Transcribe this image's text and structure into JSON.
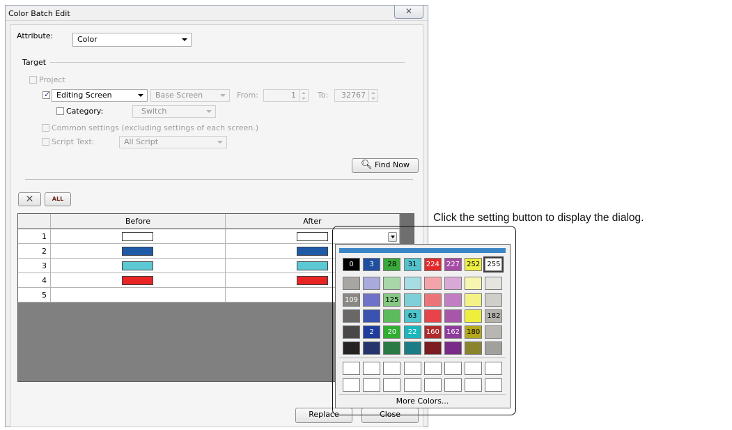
{
  "window": {
    "title": "Color Batch Edit",
    "close_glyph": "✕"
  },
  "attribute": {
    "label": "Attribute:",
    "value": "Color"
  },
  "target": {
    "label": "Target",
    "project_label": "Project",
    "scope_value": "Editing Screen",
    "screen_type": "Base Screen",
    "from_label": "From:",
    "from_value": "1",
    "to_label": "To:",
    "to_value": "32767",
    "category_label": "Category:",
    "category_value": "Switch",
    "common_label": "Common settings (excluding settings of each screen.)",
    "script_label": "Script Text:",
    "script_value": "All Script",
    "checks": {
      "project": false,
      "editing_screen": true,
      "category": false,
      "common": false,
      "script": false
    }
  },
  "find_now_label": "Find Now",
  "toolbar": {
    "delete_icon": "x-icon",
    "all_icon": "all-icon",
    "all_text": "ALL"
  },
  "table": {
    "headers": [
      "Before",
      "After"
    ],
    "rows": [
      {
        "no": "1",
        "before": "#ffffff",
        "after": "#ffffff"
      },
      {
        "no": "2",
        "before": "#1f5aa8",
        "after": "#1f5aa8"
      },
      {
        "no": "3",
        "before": "#5cc8d4",
        "after": "#5cc8d4"
      },
      {
        "no": "4",
        "before": "#e82424",
        "after": "#e82424"
      },
      {
        "no": "5",
        "before": "",
        "after": ""
      }
    ]
  },
  "buttons": {
    "replace": "Replace",
    "close": "Close"
  },
  "palette": {
    "rows": [
      [
        {
          "c": "#000000",
          "t": "0",
          "fg": "#ffffff"
        },
        {
          "c": "#1f4f9e",
          "t": "3",
          "fg": "#ffffff"
        },
        {
          "c": "#3aa83a",
          "t": "28",
          "fg": "#000000"
        },
        {
          "c": "#54c2cc",
          "t": "31",
          "fg": "#000000"
        },
        {
          "c": "#e32a2a",
          "t": "224",
          "fg": "#ffffff"
        },
        {
          "c": "#a64ca6",
          "t": "227",
          "fg": "#ffffff"
        },
        {
          "c": "#eeee44",
          "t": "252",
          "fg": "#000000"
        },
        {
          "c": "#ffffff",
          "t": "255",
          "fg": "#000000",
          "sel": true
        }
      ],
      [
        {
          "c": "#a8a6a3",
          "t": ""
        },
        {
          "c": "#a8aadc",
          "t": ""
        },
        {
          "c": "#a9d6a9",
          "t": ""
        },
        {
          "c": "#a8dce3",
          "t": ""
        },
        {
          "c": "#f4a4a8",
          "t": ""
        },
        {
          "c": "#d8a8d6",
          "t": ""
        },
        {
          "c": "#f6f6b0",
          "t": ""
        },
        {
          "c": "#e6e4de",
          "t": ""
        }
      ],
      [
        {
          "c": "#8a8884",
          "t": "109",
          "fg": "#ffffff"
        },
        {
          "c": "#6e72c8",
          "t": ""
        },
        {
          "c": "#84c884",
          "t": "125",
          "fg": "#000000"
        },
        {
          "c": "#7ed0d8",
          "t": ""
        },
        {
          "c": "#ec7478",
          "t": ""
        },
        {
          "c": "#c27ec2",
          "t": ""
        },
        {
          "c": "#f4f284",
          "t": ""
        },
        {
          "c": "#d0cec8",
          "t": ""
        }
      ],
      [
        {
          "c": "#6a6866",
          "t": ""
        },
        {
          "c": "#3a52b0",
          "t": ""
        },
        {
          "c": "#5cbc5c",
          "t": ""
        },
        {
          "c": "#4cc4cc",
          "t": "63",
          "fg": "#000000"
        },
        {
          "c": "#e8424a",
          "t": ""
        },
        {
          "c": "#a856a8",
          "t": ""
        },
        {
          "c": "#eeee3c",
          "t": ""
        },
        {
          "c": "#b4b2ac",
          "t": "182",
          "fg": "#000000"
        }
      ],
      [
        {
          "c": "#4a4846",
          "t": ""
        },
        {
          "c": "#1e3c9c",
          "t": "2",
          "fg": "#ffffff"
        },
        {
          "c": "#2fae2f",
          "t": "20",
          "fg": "#ffffff"
        },
        {
          "c": "#1ab6bc",
          "t": "22",
          "fg": "#ffffff"
        },
        {
          "c": "#b02a2a",
          "t": "160",
          "fg": "#ffffff"
        },
        {
          "c": "#8e3a9e",
          "t": "162",
          "fg": "#ffffff"
        },
        {
          "c": "#b4a81e",
          "t": "180",
          "fg": "#000000"
        },
        {
          "c": "#b8b6b0",
          "t": ""
        }
      ],
      [
        {
          "c": "#262422",
          "t": ""
        },
        {
          "c": "#26346e",
          "t": ""
        },
        {
          "c": "#2a7a44",
          "t": ""
        },
        {
          "c": "#1c7c86",
          "t": ""
        },
        {
          "c": "#7c1c22",
          "t": ""
        },
        {
          "c": "#7a2a88",
          "t": ""
        },
        {
          "c": "#8a842e",
          "t": ""
        },
        {
          "c": "#a2a09c",
          "t": ""
        }
      ]
    ],
    "custom_rows": 2,
    "more_colors": "More Colors..."
  },
  "annotation": "Click the setting button to display the dialog."
}
